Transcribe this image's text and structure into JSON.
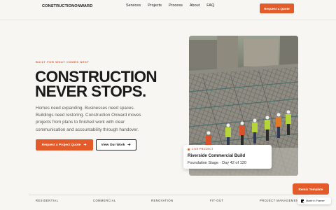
{
  "nav": {
    "brand": "CONSTRUCTIONONWARD",
    "links": [
      "Services",
      "Projects",
      "Process",
      "About",
      "FAQ"
    ],
    "cta": "Request a Quote"
  },
  "hero": {
    "eyebrow": "BUILT FOR WHAT COMES NEXT",
    "headline_line1": "CONSTRUCTION",
    "headline_line2": "NEVER STOPS.",
    "lead": "Homes need expanding. Businesses need spaces. Buildings need restoring. Construction Onward moves projects from plans to finished work with clear communication and accountability through handover.",
    "primary_button": "Request a Project Quote",
    "secondary_button": "View Our Work",
    "arrow_icon": "arrow-right-icon"
  },
  "live_project": {
    "badge": "LIVE PROJECT",
    "title": "Riverside Commercial Build",
    "status": "Foundation Stage · Day 42 of 120"
  },
  "services_strip": [
    "RESIDENTIAL",
    "COMMERCIAL",
    "RENOVATION",
    "FIT-OUT",
    "PROJECT MANAGEMENT"
  ],
  "overlay": {
    "remix": "Remix Template",
    "framer": "Made in Framer"
  },
  "colors": {
    "accent": "#e35a2b",
    "background": "#f7f6f3",
    "text": "#1a1a1a"
  }
}
